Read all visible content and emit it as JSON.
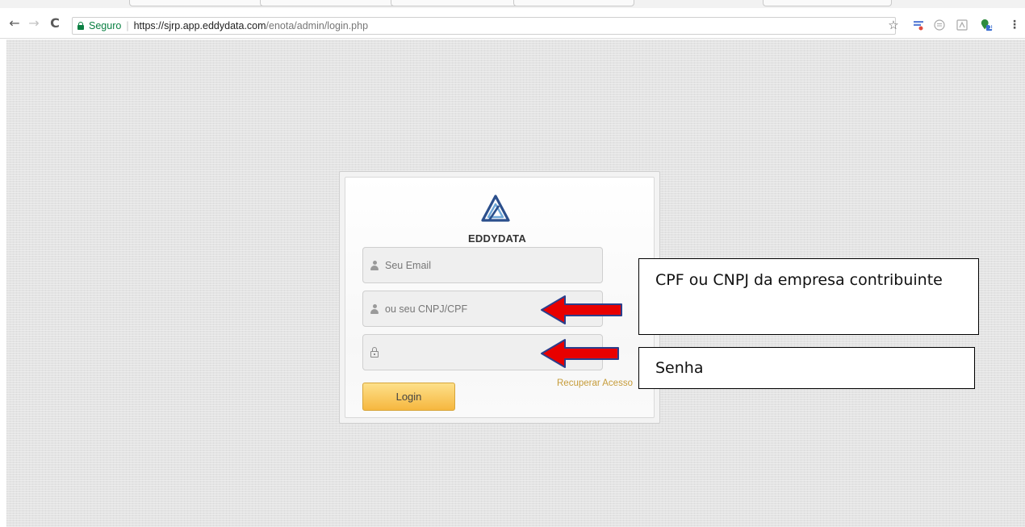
{
  "browser": {
    "secure_label": "Seguro",
    "url_host": "https://sjrp.app.eddydata.com",
    "url_path": "/enota/admin/login.php",
    "icons": {
      "back": "back-arrow-icon",
      "forward": "forward-arrow-icon",
      "reload": "reload-icon",
      "lock": "lock-icon",
      "bookmark": "star-icon",
      "menu": "kebab-menu-icon"
    },
    "extensions_badge": "1"
  },
  "login": {
    "brand_name": "EDDYDATA",
    "email_placeholder": "Seu Email",
    "cnpj_placeholder": "ou seu CNPJ/CPF",
    "password_placeholder": "",
    "recover_label": "Recuperar Acesso",
    "login_button_label": "Login"
  },
  "annotations": {
    "cnpj_note": "CPF ou CNPJ da empresa contribuinte",
    "password_note": "Senha",
    "arrow_color": "#e80000"
  },
  "colors": {
    "secure_green": "#0b8043",
    "login_button": "#f6b73f",
    "recover_link": "#c69c3a",
    "logo_blue": "#2b4f8c"
  }
}
